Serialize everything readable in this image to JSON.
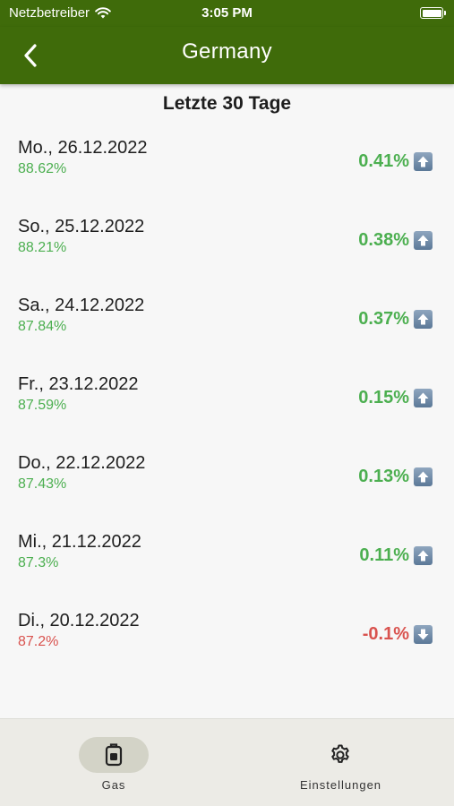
{
  "status_bar": {
    "carrier": "Netzbetreiber",
    "time": "3:05 PM"
  },
  "nav": {
    "title": "Germany"
  },
  "section": {
    "title": "Letzte 30 Tage"
  },
  "colors": {
    "header": "#3f6b0a",
    "positive": "#4caf50",
    "negative": "#d9534f"
  },
  "rows": [
    {
      "date": "Mo., 26.12.2022",
      "level": "88.62%",
      "change": "0.41%",
      "trend": "up",
      "sign": "pos"
    },
    {
      "date": "So., 25.12.2022",
      "level": "88.21%",
      "change": "0.38%",
      "trend": "up",
      "sign": "pos"
    },
    {
      "date": "Sa., 24.12.2022",
      "level": "87.84%",
      "change": "0.37%",
      "trend": "up",
      "sign": "pos"
    },
    {
      "date": "Fr., 23.12.2022",
      "level": "87.59%",
      "change": "0.15%",
      "trend": "up",
      "sign": "pos"
    },
    {
      "date": "Do., 22.12.2022",
      "level": "87.43%",
      "change": "0.13%",
      "trend": "up",
      "sign": "pos"
    },
    {
      "date": "Mi., 21.12.2022",
      "level": "87.3%",
      "change": "0.11%",
      "trend": "up",
      "sign": "pos"
    },
    {
      "date": "Di., 20.12.2022",
      "level": "87.2%",
      "change": "-0.1%",
      "trend": "down",
      "sign": "neg"
    }
  ],
  "tabs": [
    {
      "label": "Gas",
      "icon": "gas-tank-icon",
      "selected": true
    },
    {
      "label": "Einstellungen",
      "icon": "gear-icon",
      "selected": false
    }
  ]
}
